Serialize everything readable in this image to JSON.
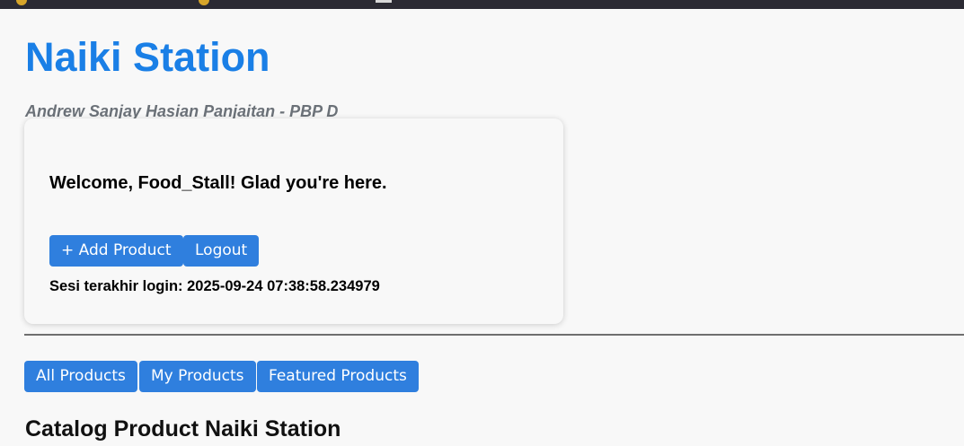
{
  "header": {
    "title": "Naiki Station",
    "subtitle": "Andrew Sanjay Hasian Panjaitan - PBP D"
  },
  "welcome_card": {
    "message": "Welcome, Food_Stall! Glad you're here.",
    "add_product_label": "+ Add Product",
    "logout_label": "Logout",
    "last_login": "Sesi terakhir login: 2025-09-24 07:38:58.234979"
  },
  "filters": {
    "all_label": "All Products",
    "mine_label": "My Products",
    "featured_label": "Featured Products"
  },
  "catalog": {
    "title": "Catalog Product Naiki Station"
  },
  "colors": {
    "title_blue": "#1a7fe6",
    "button_blue": "#2f7fde",
    "subtitle_gray": "#6b7178"
  }
}
